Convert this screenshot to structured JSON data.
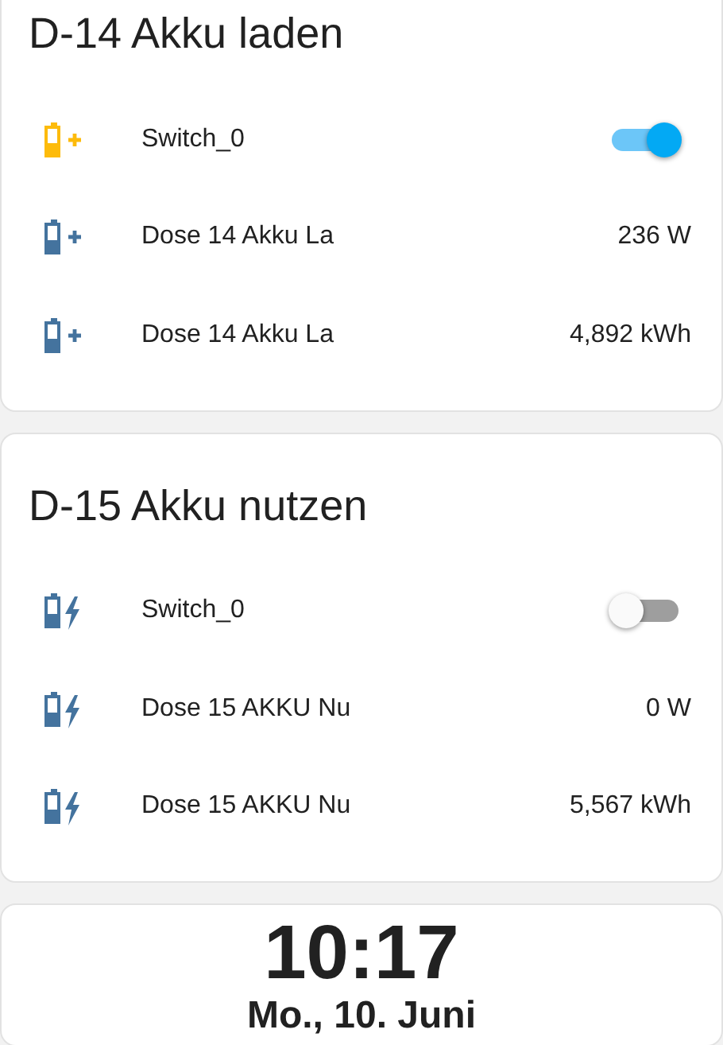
{
  "cards": [
    {
      "title": "D-14 Akku laden",
      "kind": "charging",
      "rows": [
        {
          "kind": "switch",
          "name": "Switch_0",
          "on": true
        },
        {
          "kind": "sensor",
          "name": "Dose 14 Akku La",
          "value": "236 W"
        },
        {
          "kind": "sensor",
          "name": "Dose 14 Akku La",
          "value": "4,892 kWh"
        }
      ]
    },
    {
      "title": "D-15 Akku nutzen",
      "kind": "discharging",
      "rows": [
        {
          "kind": "switch",
          "name": "Switch_0",
          "on": false
        },
        {
          "kind": "sensor",
          "name": "Dose 15 AKKU Nu",
          "value": "0 W"
        },
        {
          "kind": "sensor",
          "name": "Dose 15 AKKU Nu",
          "value": "5,567 kWh"
        }
      ]
    }
  ],
  "clock": {
    "time": "10:17",
    "date": "Mo., 10. Juni"
  }
}
